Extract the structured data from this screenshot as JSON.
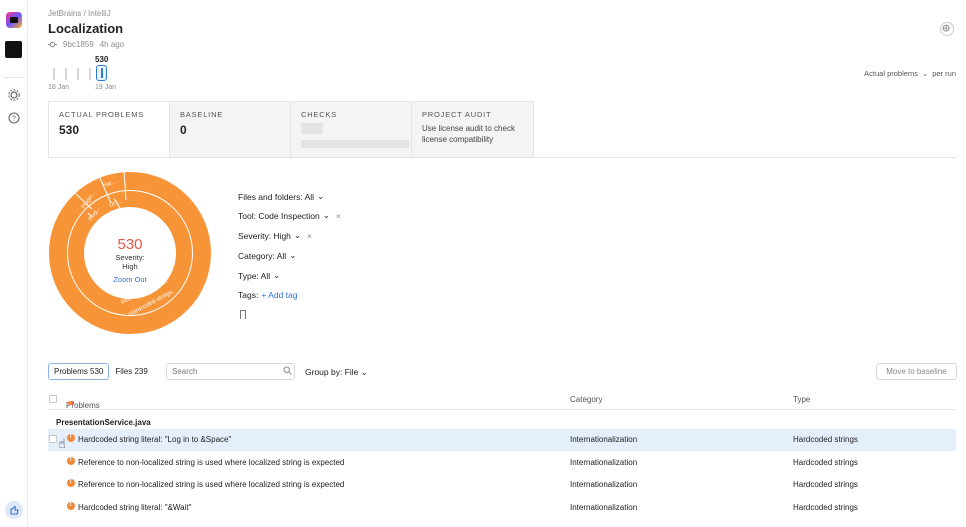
{
  "app": {
    "breadcrumb": "JetBrains / IntelliJ",
    "title": "Localization",
    "commit": "9bc1859",
    "time_ago": "4h ago"
  },
  "timeline": {
    "selected_value": "530",
    "start_date": "18 Jan",
    "end_date": "19 Jan",
    "mode": "Actual problems",
    "mode_suffix": "per run"
  },
  "metrics": [
    {
      "label": "ACTUAL PROBLEMS",
      "value": "530"
    },
    {
      "label": "BASELINE",
      "value": "0"
    },
    {
      "label": "CHECKS",
      "value": ""
    },
    {
      "label": "PROJECT AUDIT",
      "desc1": "Use license audit to check",
      "desc2": "license compatibility"
    }
  ],
  "donut": {
    "total": "530",
    "label_line1": "Severity:",
    "label_line2": "High",
    "zoom": "Zoom Out",
    "outer_ring_label": "Hardcoded strings",
    "inner_ring_label": "Internationalization",
    "small_labels": [
      "Plugin...",
      "Har...",
      "Plug...",
      "UI f..."
    ],
    "color": "#f89438"
  },
  "filters": {
    "files": "Files and folders: All",
    "tool": "Tool: Code Inspection",
    "severity": "Severity: High",
    "category": "Category: All",
    "type": "Type: All",
    "tags_label": "Tags:",
    "add_tag": "+ Add tag"
  },
  "toolbar": {
    "tab_problems": "Problems 530",
    "tab_files": "Files 239",
    "search_placeholder": "Search",
    "group_by": "Group by: File",
    "move_to_baseline": "Move to baseline"
  },
  "table": {
    "headers": {
      "problems": "Problems",
      "category": "Category",
      "type": "Type"
    },
    "group": "PresentationService.java",
    "rows": [
      {
        "problem": "Hardcoded string literal: \"Log in to &Space\"",
        "category": "Internationalization",
        "type": "Hardcoded strings"
      },
      {
        "problem": "Reference to non-localized string is used where localized string is expected",
        "category": "Internationalization",
        "type": "Hardcoded strings"
      },
      {
        "problem": "Reference to non-localized string is used where localized string is expected",
        "category": "Internationalization",
        "type": "Hardcoded strings"
      },
      {
        "problem": "Hardcoded string literal: \"&Wait\"",
        "category": "Internationalization",
        "type": "Hardcoded strings"
      }
    ]
  },
  "colors": {
    "accent": "#2f7bd6",
    "severity_high": "#f0883a",
    "total_red": "#e45545"
  }
}
